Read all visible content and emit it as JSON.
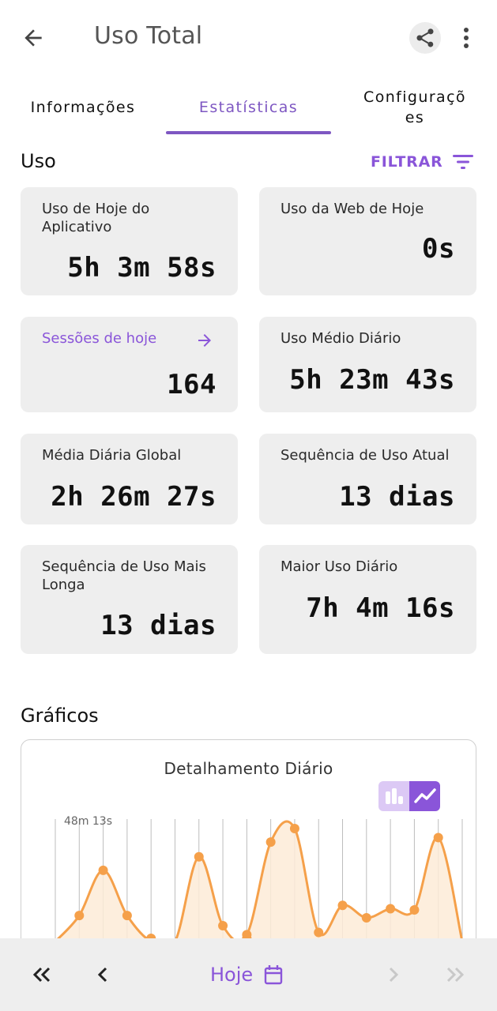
{
  "header": {
    "title": "Uso Total"
  },
  "tabs": [
    {
      "label": "Informações",
      "active": false
    },
    {
      "label": "Estatísticas",
      "active": true
    },
    {
      "label": "Configurações",
      "line1": "Configuraçõ",
      "line2": "es",
      "active": false
    }
  ],
  "usage": {
    "title": "Uso",
    "filter_label": "FILTRAR",
    "cards": [
      {
        "label": "Uso de Hoje do Aplicativo",
        "value": "5h 3m 58s"
      },
      {
        "label": "Uso da Web de Hoje",
        "value": "0s"
      },
      {
        "label": "Sessões de hoje",
        "value": "164"
      },
      {
        "label": "Uso Médio Diário",
        "value": "5h 23m 43s"
      },
      {
        "label": "Média Diária Global",
        "value": "2h 26m 27s"
      },
      {
        "label": "Sequência de Uso Atual",
        "value": "13 dias"
      },
      {
        "label": "Sequência de Uso Mais Longa",
        "value": "13 dias"
      },
      {
        "label": "Maior Uso Diário",
        "value": "7h 4m 16s"
      }
    ]
  },
  "charts": {
    "title": "Gráficos",
    "chart_title": "Detalhamento Diário",
    "max_label": "48m 13s"
  },
  "chart_data": {
    "type": "area",
    "title": "Detalhamento Diário",
    "max_label": "48m 13s",
    "series_values_fraction_of_max": [
      0.0,
      0.23,
      0.63,
      0.23,
      0.0,
      0.0,
      0.75,
      0.14,
      0.06,
      0.88,
      1.0,
      0.08,
      0.32,
      0.21,
      0.29,
      0.28,
      0.92,
      0.0
    ],
    "view_toggle": [
      "bar",
      "line"
    ],
    "active_view": "line",
    "colors": {
      "line": "#f5a04a",
      "fill": "#fdebd7",
      "grid": "#bdbdbd"
    }
  },
  "bottom_nav": {
    "date_label": "Hoje",
    "first_icon": "double-chevron-left-icon",
    "prev_icon": "chevron-left-icon",
    "next_icon": "chevron-right-icon",
    "last_icon": "double-chevron-right-icon"
  },
  "colors": {
    "accent": "#8a55d9",
    "card_bg": "#eeeeee",
    "bar_bg": "#eeeeee"
  }
}
